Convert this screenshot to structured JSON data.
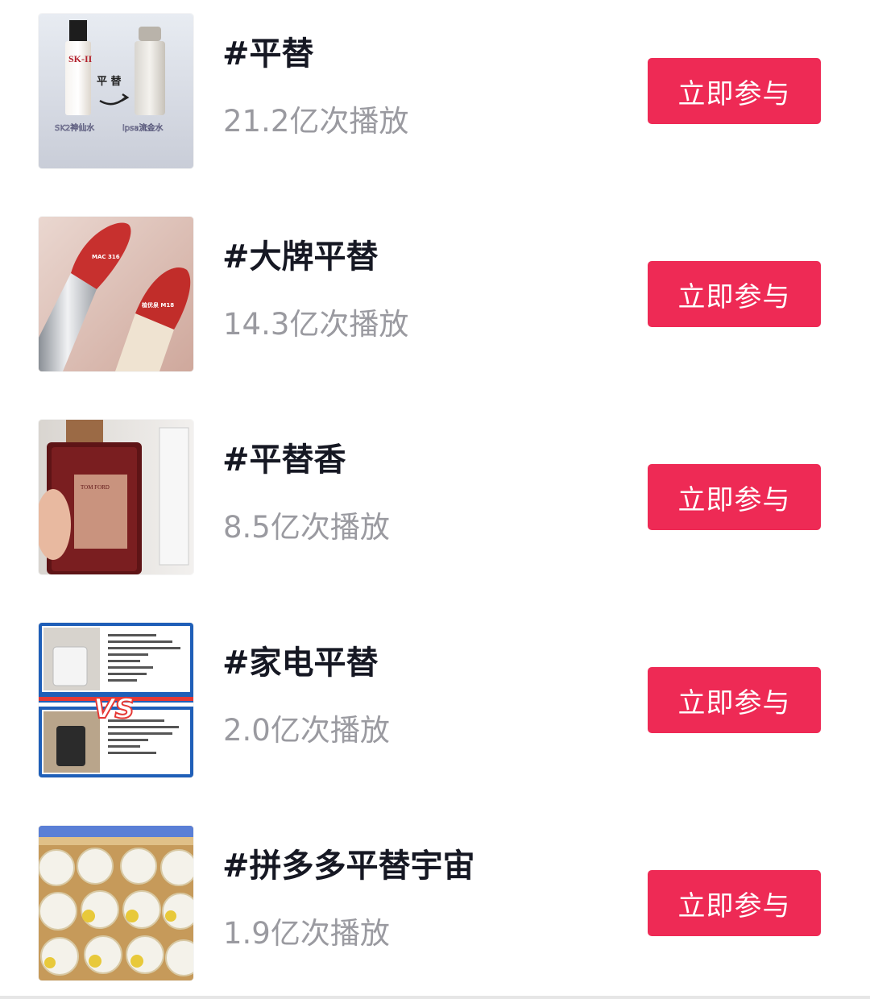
{
  "topics": [
    {
      "title": "#平替",
      "plays": "21.2亿次播放",
      "button_label": "立即参与",
      "thumb_text": [
        "SK-II",
        "平 替",
        "SK2神仙水",
        "ipsa流金水"
      ]
    },
    {
      "title": "#大牌平替",
      "plays": "14.3亿次播放",
      "button_label": "立即参与",
      "thumb_text": [
        "MAC 316",
        "植优泉 M18"
      ]
    },
    {
      "title": "#平替香",
      "plays": "8.5亿次播放",
      "button_label": "立即参与",
      "thumb_text": [
        "TOM FORD"
      ]
    },
    {
      "title": "#家电平替",
      "plays": "2.0亿次播放",
      "button_label": "立即参与",
      "thumb_text": [
        "VS"
      ]
    },
    {
      "title": "#拼多多平替宇宙",
      "plays": "1.9亿次播放",
      "button_label": "立即参与",
      "thumb_text": []
    }
  ],
  "colors": {
    "button": "#ee2a55",
    "title": "#161823",
    "plays": "#9a9aa0"
  }
}
